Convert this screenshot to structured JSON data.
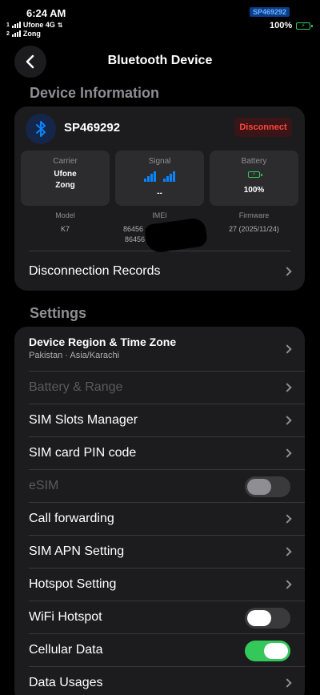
{
  "status_bar": {
    "time": "6:24 AM",
    "sim1": {
      "index": "1",
      "name": "Ufone 4G"
    },
    "sim2": {
      "index": "2",
      "name": "Zong"
    },
    "device_badge": "SP469292",
    "battery_percent": "100%"
  },
  "nav": {
    "title": "Bluetooth Device"
  },
  "device_info": {
    "section_title": "Device Information",
    "device_name": "SP469292",
    "disconnect_label": "Disconnect",
    "carrier": {
      "label": "Carrier",
      "line1": "Ufone",
      "line2": "Zong"
    },
    "signal": {
      "label": "Signal",
      "value": "--"
    },
    "battery": {
      "label": "Battery",
      "value": "100%"
    },
    "model": {
      "label": "Model",
      "value": "K7"
    },
    "imei": {
      "label": "IMEI",
      "line1": "86456",
      "line2": "86456"
    },
    "firmware": {
      "label": "Firmware",
      "value": "27 (2025/11/24)"
    },
    "records_label": "Disconnection Records"
  },
  "settings": {
    "section_title": "Settings",
    "region_title": "Device Region & Time Zone",
    "region_subtitle": "Pakistan · Asia/Karachi",
    "battery_range": "Battery & Range",
    "sim_slots": "SIM Slots Manager",
    "sim_pin": "SIM card PIN code",
    "esim": "eSIM",
    "call_forwarding": "Call forwarding",
    "sim_apn": "SIM APN Setting",
    "hotspot_setting": "Hotspot Setting",
    "wifi_hotspot": "WiFi Hotspot",
    "cellular_data": "Cellular Data",
    "data_usages": "Data Usages"
  },
  "toggles": {
    "esim": false,
    "wifi_hotspot": false,
    "cellular_data": true
  },
  "colors": {
    "accent_blue": "#0a84ff",
    "danger_red": "#ff453a",
    "success_green": "#34c759"
  }
}
